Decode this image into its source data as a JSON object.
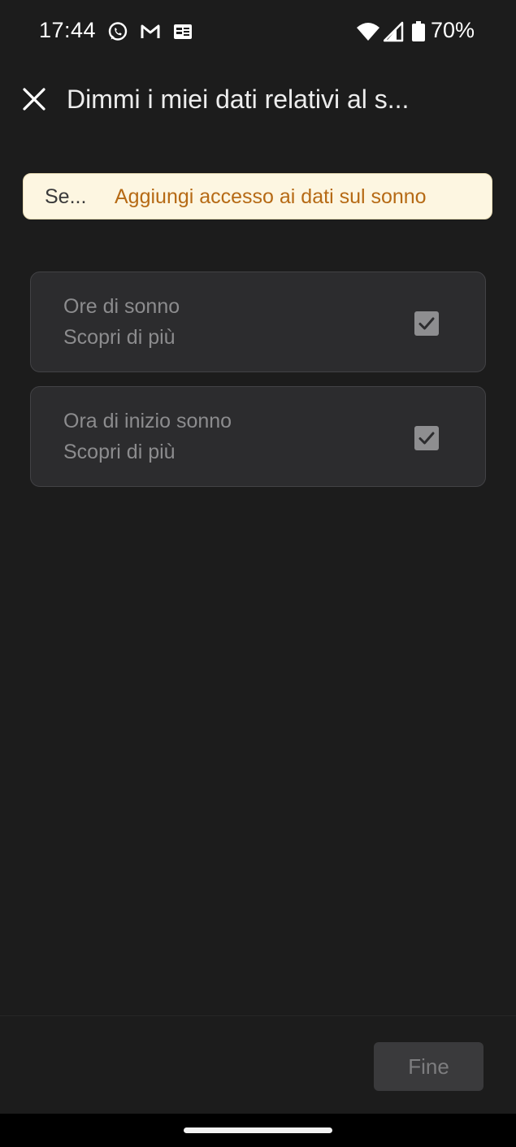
{
  "status_bar": {
    "time": "17:44",
    "battery": "70%",
    "icons": [
      "whatsapp-icon",
      "gmail-icon",
      "news-icon",
      "wifi-icon",
      "signal-icon",
      "battery-icon"
    ]
  },
  "app_bar": {
    "title": "Dimmi i miei dati relativi al s...",
    "close_icon": "close-icon"
  },
  "banner": {
    "lead": "Se...",
    "action": "Aggiungi accesso ai dati sul sonno",
    "background": "#fdf6e1",
    "action_color": "#b66a15"
  },
  "permissions": [
    {
      "title": "Ore di sonno",
      "link": "Scopri di più",
      "checked": true
    },
    {
      "title": "Ora di inizio sonno",
      "link": "Scopri di più",
      "checked": true
    }
  ],
  "footer": {
    "done_label": "Fine"
  }
}
